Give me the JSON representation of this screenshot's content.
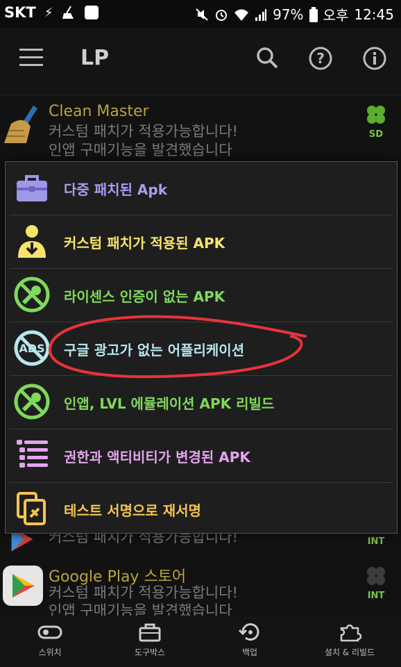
{
  "status": {
    "carrier": "SKT",
    "battery": "97%",
    "ampm": "오후",
    "time": "12:45"
  },
  "appbar": {
    "title": "LP"
  },
  "list": [
    {
      "title": "Clean Master",
      "line1": "커스텀 패치가 적용가능합니다!",
      "line2": "인앱 구매기능을 발견했습니다",
      "badge": "SD"
    },
    {
      "title": "",
      "line1": "커스텀 패치가 적용가능합니다!",
      "line2": "",
      "badge": "INT"
    },
    {
      "title": "Google Play 스토어",
      "line1": "커스텀 패치가 적용가능합니다!",
      "line2": "인앱 구매기능을 발견했습니다",
      "badge": "INT"
    }
  ],
  "popup": {
    "items": [
      {
        "label": "다중 패치된 Apk",
        "color": "#a79df2"
      },
      {
        "label": "커스텀 패치가 적용된 APK",
        "color": "#f7e46a"
      },
      {
        "label": "라이센스 인증이 없는 APK",
        "color": "#7fd95b"
      },
      {
        "label": "구글 광고가 없는 어플리케이션",
        "color": "#b8e6ee"
      },
      {
        "label": "인앱, LVL 에뮬레이션 APK 리빌드",
        "color": "#7fd95b"
      },
      {
        "label": "권한과 액티비티가 변경된 APK",
        "color": "#e3a5ee"
      },
      {
        "label": "테스트 서명으로 재서명",
        "color": "#f6c453"
      }
    ]
  },
  "navbar": {
    "items": [
      {
        "label": "스위치"
      },
      {
        "label": "도구박스"
      },
      {
        "label": "백업"
      },
      {
        "label": "설치 & 리빌드"
      }
    ]
  },
  "colors": {
    "annotation": "#e8333a",
    "accent_green": "#7cc447"
  }
}
